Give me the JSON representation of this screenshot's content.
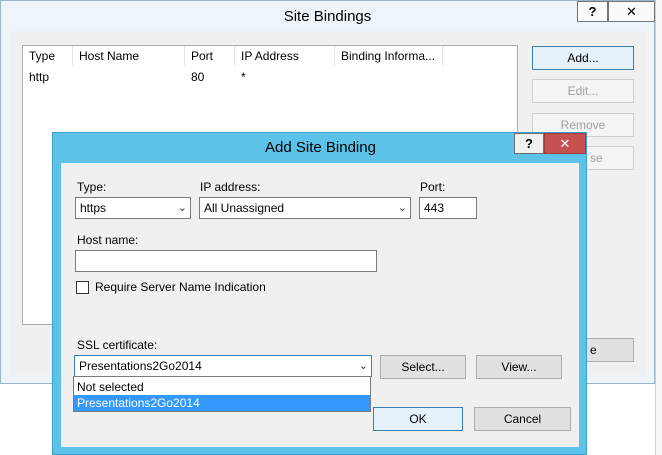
{
  "site_bindings": {
    "title": "Site Bindings",
    "help_glyph": "?",
    "close_glyph": "✕",
    "columns": [
      "Type",
      "Host Name",
      "Port",
      "IP Address",
      "Binding Informa..."
    ],
    "rows": [
      {
        "type": "http",
        "host_name": "",
        "port": "80",
        "ip_address": "*",
        "binding_info": ""
      }
    ],
    "buttons": {
      "add": "Add...",
      "edit": "Edit...",
      "remove": "Remove",
      "browse_partial": "se",
      "close_partial": "e"
    }
  },
  "add_site_binding": {
    "title": "Add Site Binding",
    "help_glyph": "?",
    "close_glyph": "✕",
    "type_label": "Type:",
    "type_value": "https",
    "ip_label": "IP address:",
    "ip_value": "All Unassigned",
    "port_label": "Port:",
    "port_value": "443",
    "host_label": "Host name:",
    "host_value": "",
    "sni_label": "Require Server Name Indication",
    "sni_checked": false,
    "ssl_label": "SSL certificate:",
    "ssl_value": "Presentations2Go2014",
    "ssl_options": [
      "Not selected",
      "Presentations2Go2014"
    ],
    "ssl_selected_index": 1,
    "select_button": "Select...",
    "view_button": "View...",
    "ok_button": "OK",
    "cancel_button": "Cancel"
  },
  "colors": {
    "dialog_frame": "#5cc2e8",
    "close_button": "#c75050",
    "selection": "#3399ff"
  }
}
